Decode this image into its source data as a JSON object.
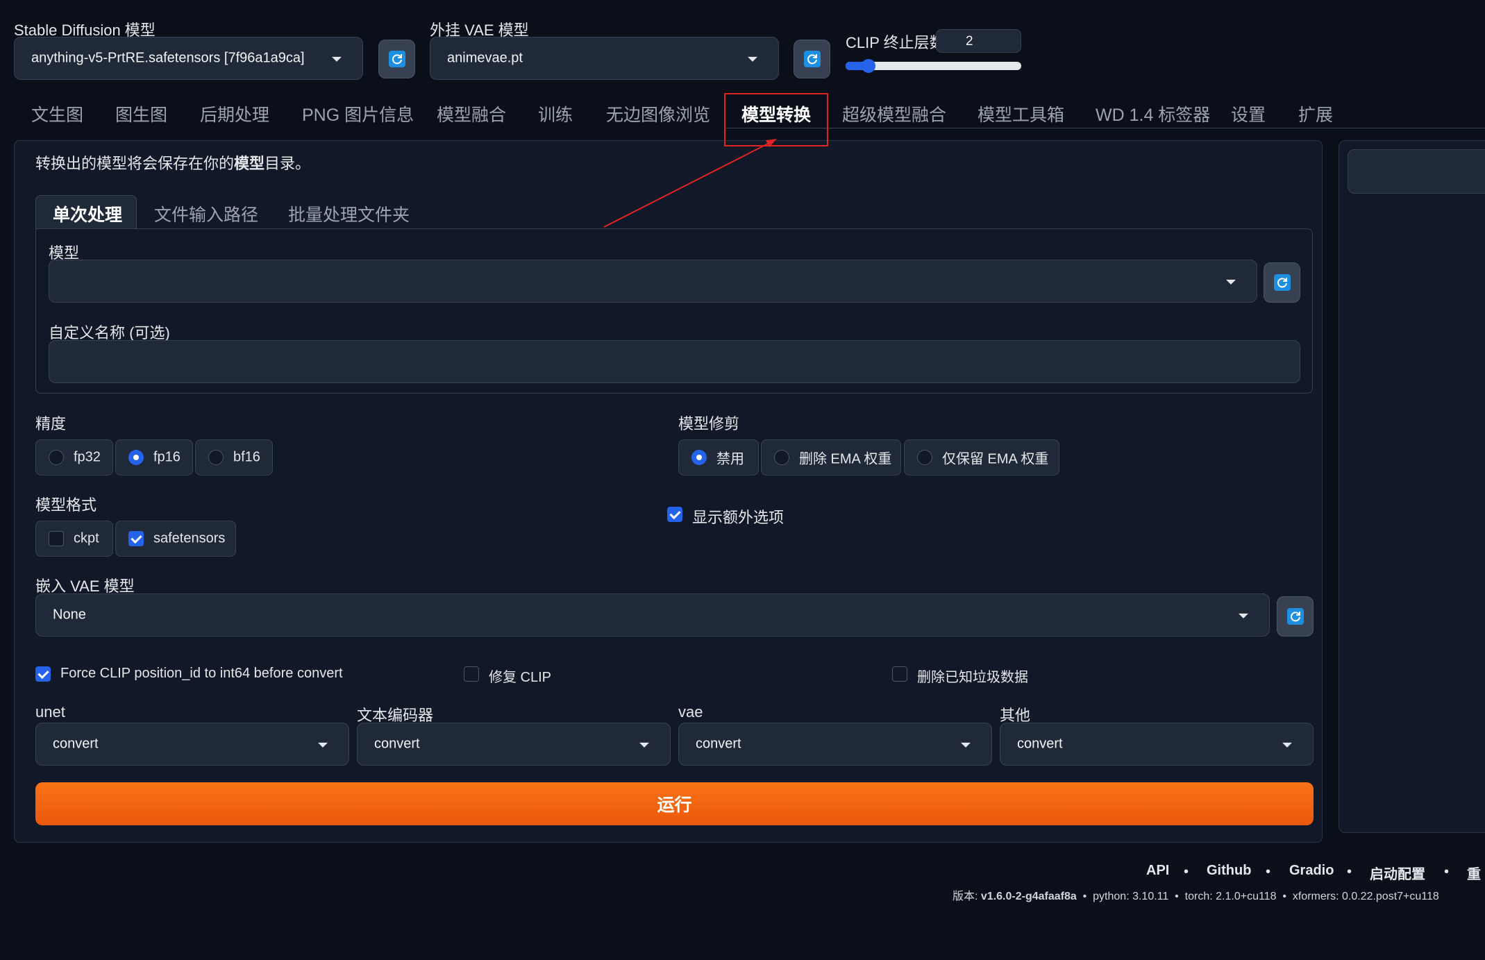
{
  "top": {
    "sd_model": {
      "label": "Stable Diffusion 模型",
      "value": "anything-v5-PrtRE.safetensors [7f96a1a9ca]"
    },
    "vae_model": {
      "label": "外挂 VAE 模型",
      "value": "animevae.pt"
    },
    "clip": {
      "label": "CLIP 终止层数",
      "value": "2",
      "slider_fraction": 0.09
    }
  },
  "tabs": [
    {
      "label": "文生图"
    },
    {
      "label": "图生图"
    },
    {
      "label": "后期处理"
    },
    {
      "label": "PNG 图片信息"
    },
    {
      "label": "模型融合"
    },
    {
      "label": "训练"
    },
    {
      "label": "无边图像浏览"
    },
    {
      "label": "模型转换"
    },
    {
      "label": "超级模型融合"
    },
    {
      "label": "模型工具箱"
    },
    {
      "label": "WD 1.4 标签器"
    },
    {
      "label": "设置"
    },
    {
      "label": "扩展"
    }
  ],
  "main": {
    "info_prefix": "转换出的模型将会保存在你的",
    "info_bold": "模型",
    "info_suffix": "目录。",
    "subtabs": [
      {
        "label": "单次处理"
      },
      {
        "label": "文件输入路径"
      },
      {
        "label": "批量处理文件夹"
      }
    ],
    "model_label": "模型",
    "model_value": "",
    "custom_name_label": "自定义名称 (可选)",
    "custom_name_value": "",
    "precision": {
      "label": "精度",
      "options": [
        "fp32",
        "fp16",
        "bf16"
      ],
      "selected": "fp16"
    },
    "pruning": {
      "label": "模型修剪",
      "options": [
        "禁用",
        "删除 EMA 权重",
        "仅保留 EMA 权重"
      ],
      "selected": "禁用"
    },
    "format": {
      "label": "模型格式",
      "options": [
        "ckpt",
        "safetensors"
      ],
      "checked": [
        "safetensors"
      ]
    },
    "show_extra": {
      "label": "显示额外选项",
      "checked": true
    },
    "bake_vae": {
      "label": "嵌入 VAE 模型",
      "value": "None"
    },
    "force_clip": {
      "label": "Force CLIP position_id to int64 before convert",
      "checked": true
    },
    "fix_clip": {
      "label": "修复 CLIP",
      "checked": false
    },
    "delete_junk": {
      "label": "删除已知垃圾数据",
      "checked": false
    },
    "unet": {
      "label": "unet",
      "value": "convert"
    },
    "text_encoder": {
      "label": "文本编码器",
      "value": "convert"
    },
    "vae": {
      "label": "vae",
      "value": "convert"
    },
    "other": {
      "label": "其他",
      "value": "convert"
    },
    "run_label": "运行"
  },
  "footer": {
    "links": [
      "API",
      "Github",
      "Gradio",
      "启动配置",
      "重"
    ],
    "version_prefix": "版本: ",
    "version": "v1.6.0-2-g4afaaf8a",
    "python": "python: 3.10.11",
    "torch": "torch: 2.1.0+cu118",
    "xformers": "xformers: 0.0.22.post7+cu118"
  },
  "colors": {
    "accent": "#2563eb",
    "run_button": "#f97316",
    "annotation": "#e02424"
  }
}
